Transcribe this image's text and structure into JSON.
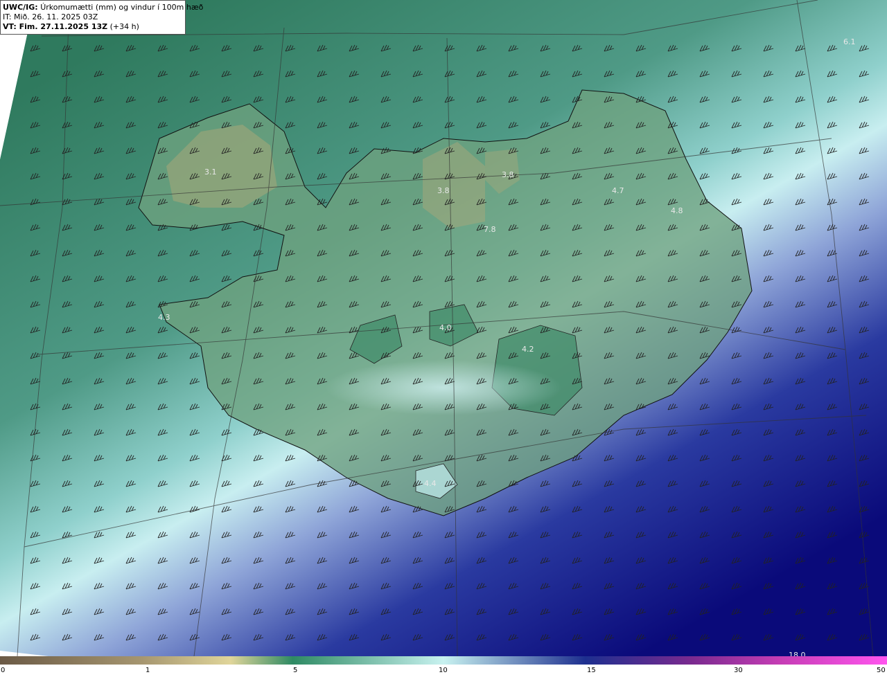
{
  "header": {
    "model": "UWC/IG:",
    "product": "Úrkomumætti (mm) og vindur í 100m hæð",
    "initial_time": "IT: Mið. 26. 11. 2025 03Z",
    "valid_prefix": "VT: Fim. 27.11.2025 13Z",
    "valid_lead": "(+34 h)"
  },
  "max_labels": [
    "6.1",
    "3.1",
    "3.8",
    "3.8",
    "4.7",
    "4.8",
    "7.8",
    "4.3",
    "4.0",
    "4.2",
    "4.4",
    "18.0"
  ],
  "colorbar": {
    "ticks": [
      "0",
      "1",
      "5",
      "10",
      "15",
      "30",
      "50"
    ],
    "colors": [
      "#6b5a46",
      "#a69670",
      "#e0d59a",
      "#2e8a63",
      "#c8f2f0",
      "#1d2f8f",
      "#7a2a8f",
      "#c63db5",
      "#ff55ee"
    ]
  },
  "colors": {
    "north_green": "#2e7a5d",
    "mid_teal": "#5fa89a",
    "light_cyan": "#bfe6ec",
    "deep_blue": "#0a0a7a",
    "land": "#6a9e78"
  }
}
